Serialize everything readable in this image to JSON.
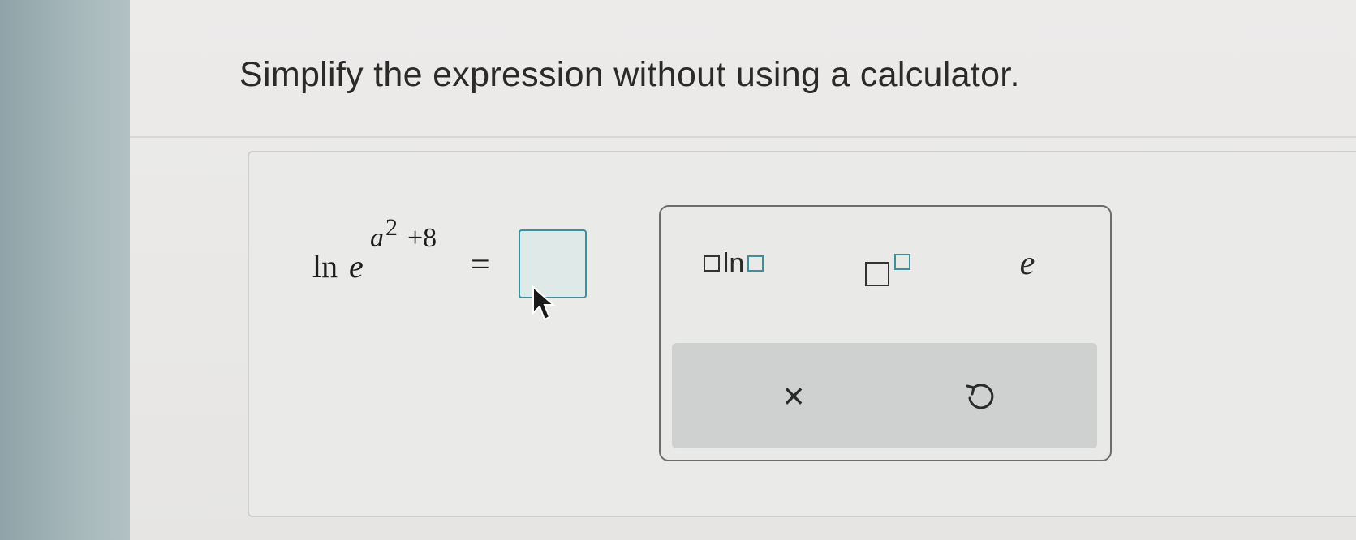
{
  "instruction": "Simplify the expression without using a calculator.",
  "expression": {
    "ln": "ln",
    "base": "e",
    "exponent_var": "a",
    "exponent_power": "2",
    "exponent_rest": "+8",
    "equals": "="
  },
  "answer": {
    "value": ""
  },
  "palette": {
    "log_button_label": "ln",
    "e_button_label": "e",
    "clear_button_label": "×",
    "icons": [
      "power-template-icon",
      "clear-icon",
      "undo-icon",
      "mouse-cursor-icon"
    ]
  },
  "colors": {
    "accent": "#3d8f9e",
    "text": "#2a2a2a",
    "answer_box_fill": "#dfe9e7"
  }
}
